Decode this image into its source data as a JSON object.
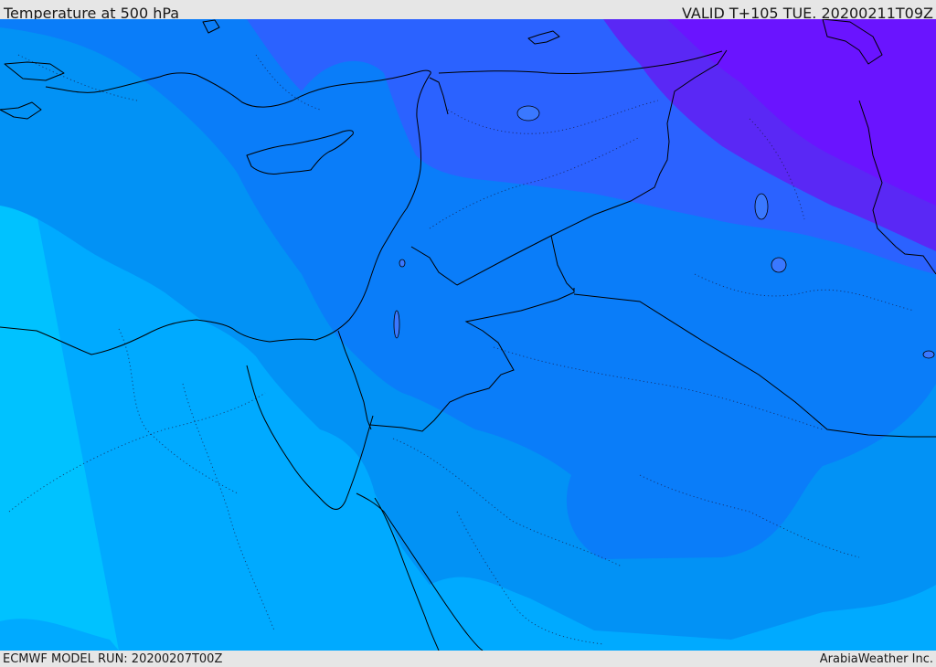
{
  "header": {
    "title": "Temperature at 500 hPa",
    "valid": "VALID T+105 TUE. 20200211T09Z"
  },
  "footer": {
    "model_run": "ECMWF MODEL RUN: 20200207T00Z",
    "credit": "ArabiaWeather Inc."
  },
  "colors": {
    "coldest": "#6a14ff",
    "very_cold": "#5a28f5",
    "cold": "#2b62ff",
    "cool": "#0a7df9",
    "mild": "#0292f5",
    "warmer": "#00aaff",
    "warmest": "#00c2ff",
    "lines": "#000000"
  }
}
